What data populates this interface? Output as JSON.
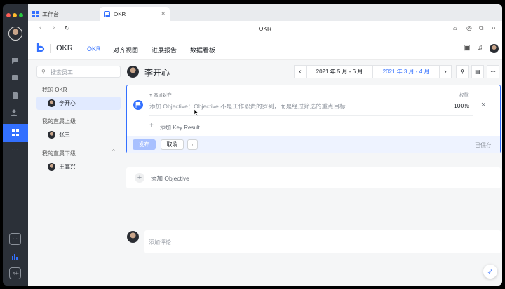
{
  "tabs": [
    {
      "label": "工作台",
      "icon": "grid-icon",
      "color": "#3370ff"
    },
    {
      "label": "OKR",
      "icon": "flag-icon",
      "color": "#3370ff"
    }
  ],
  "address": {
    "title": "OKR"
  },
  "app": {
    "name": "OKR",
    "brand_color": "#3370ff"
  },
  "nav": [
    {
      "label": "OKR",
      "active": true
    },
    {
      "label": "对齐视图"
    },
    {
      "label": "进展报告"
    },
    {
      "label": "数据看板"
    }
  ],
  "sidebar": {
    "search_placeholder": "搜索员工",
    "groups": [
      {
        "title": "我的 OKR",
        "people": [
          "李开心"
        ]
      },
      {
        "title": "我的直属上级",
        "people": [
          "张三"
        ]
      },
      {
        "title": "我的直属下级",
        "people": [
          "王高兴"
        ]
      }
    ]
  },
  "owner": {
    "name": "李开心"
  },
  "periods": [
    {
      "label": "2021 年 5 月 - 6 月",
      "selected": false
    },
    {
      "label": "2021 年 3 月 - 4 月",
      "selected": true
    }
  ],
  "editor": {
    "align_label": "+ 添加对齐",
    "weight_label": "权重",
    "objective_placeholder": "添加 Objective：Objective 不是工作职责的罗列，而是经过筛选的重点目标",
    "weight_value": "100%",
    "add_kr_label": "添加 Key Result",
    "publish_label": "发布",
    "cancel_label": "取消",
    "saved_label": "已保存"
  },
  "add_objective_label": "添加 Objective",
  "comment_placeholder": "添加评论",
  "rail_bottom_label": "飞书"
}
